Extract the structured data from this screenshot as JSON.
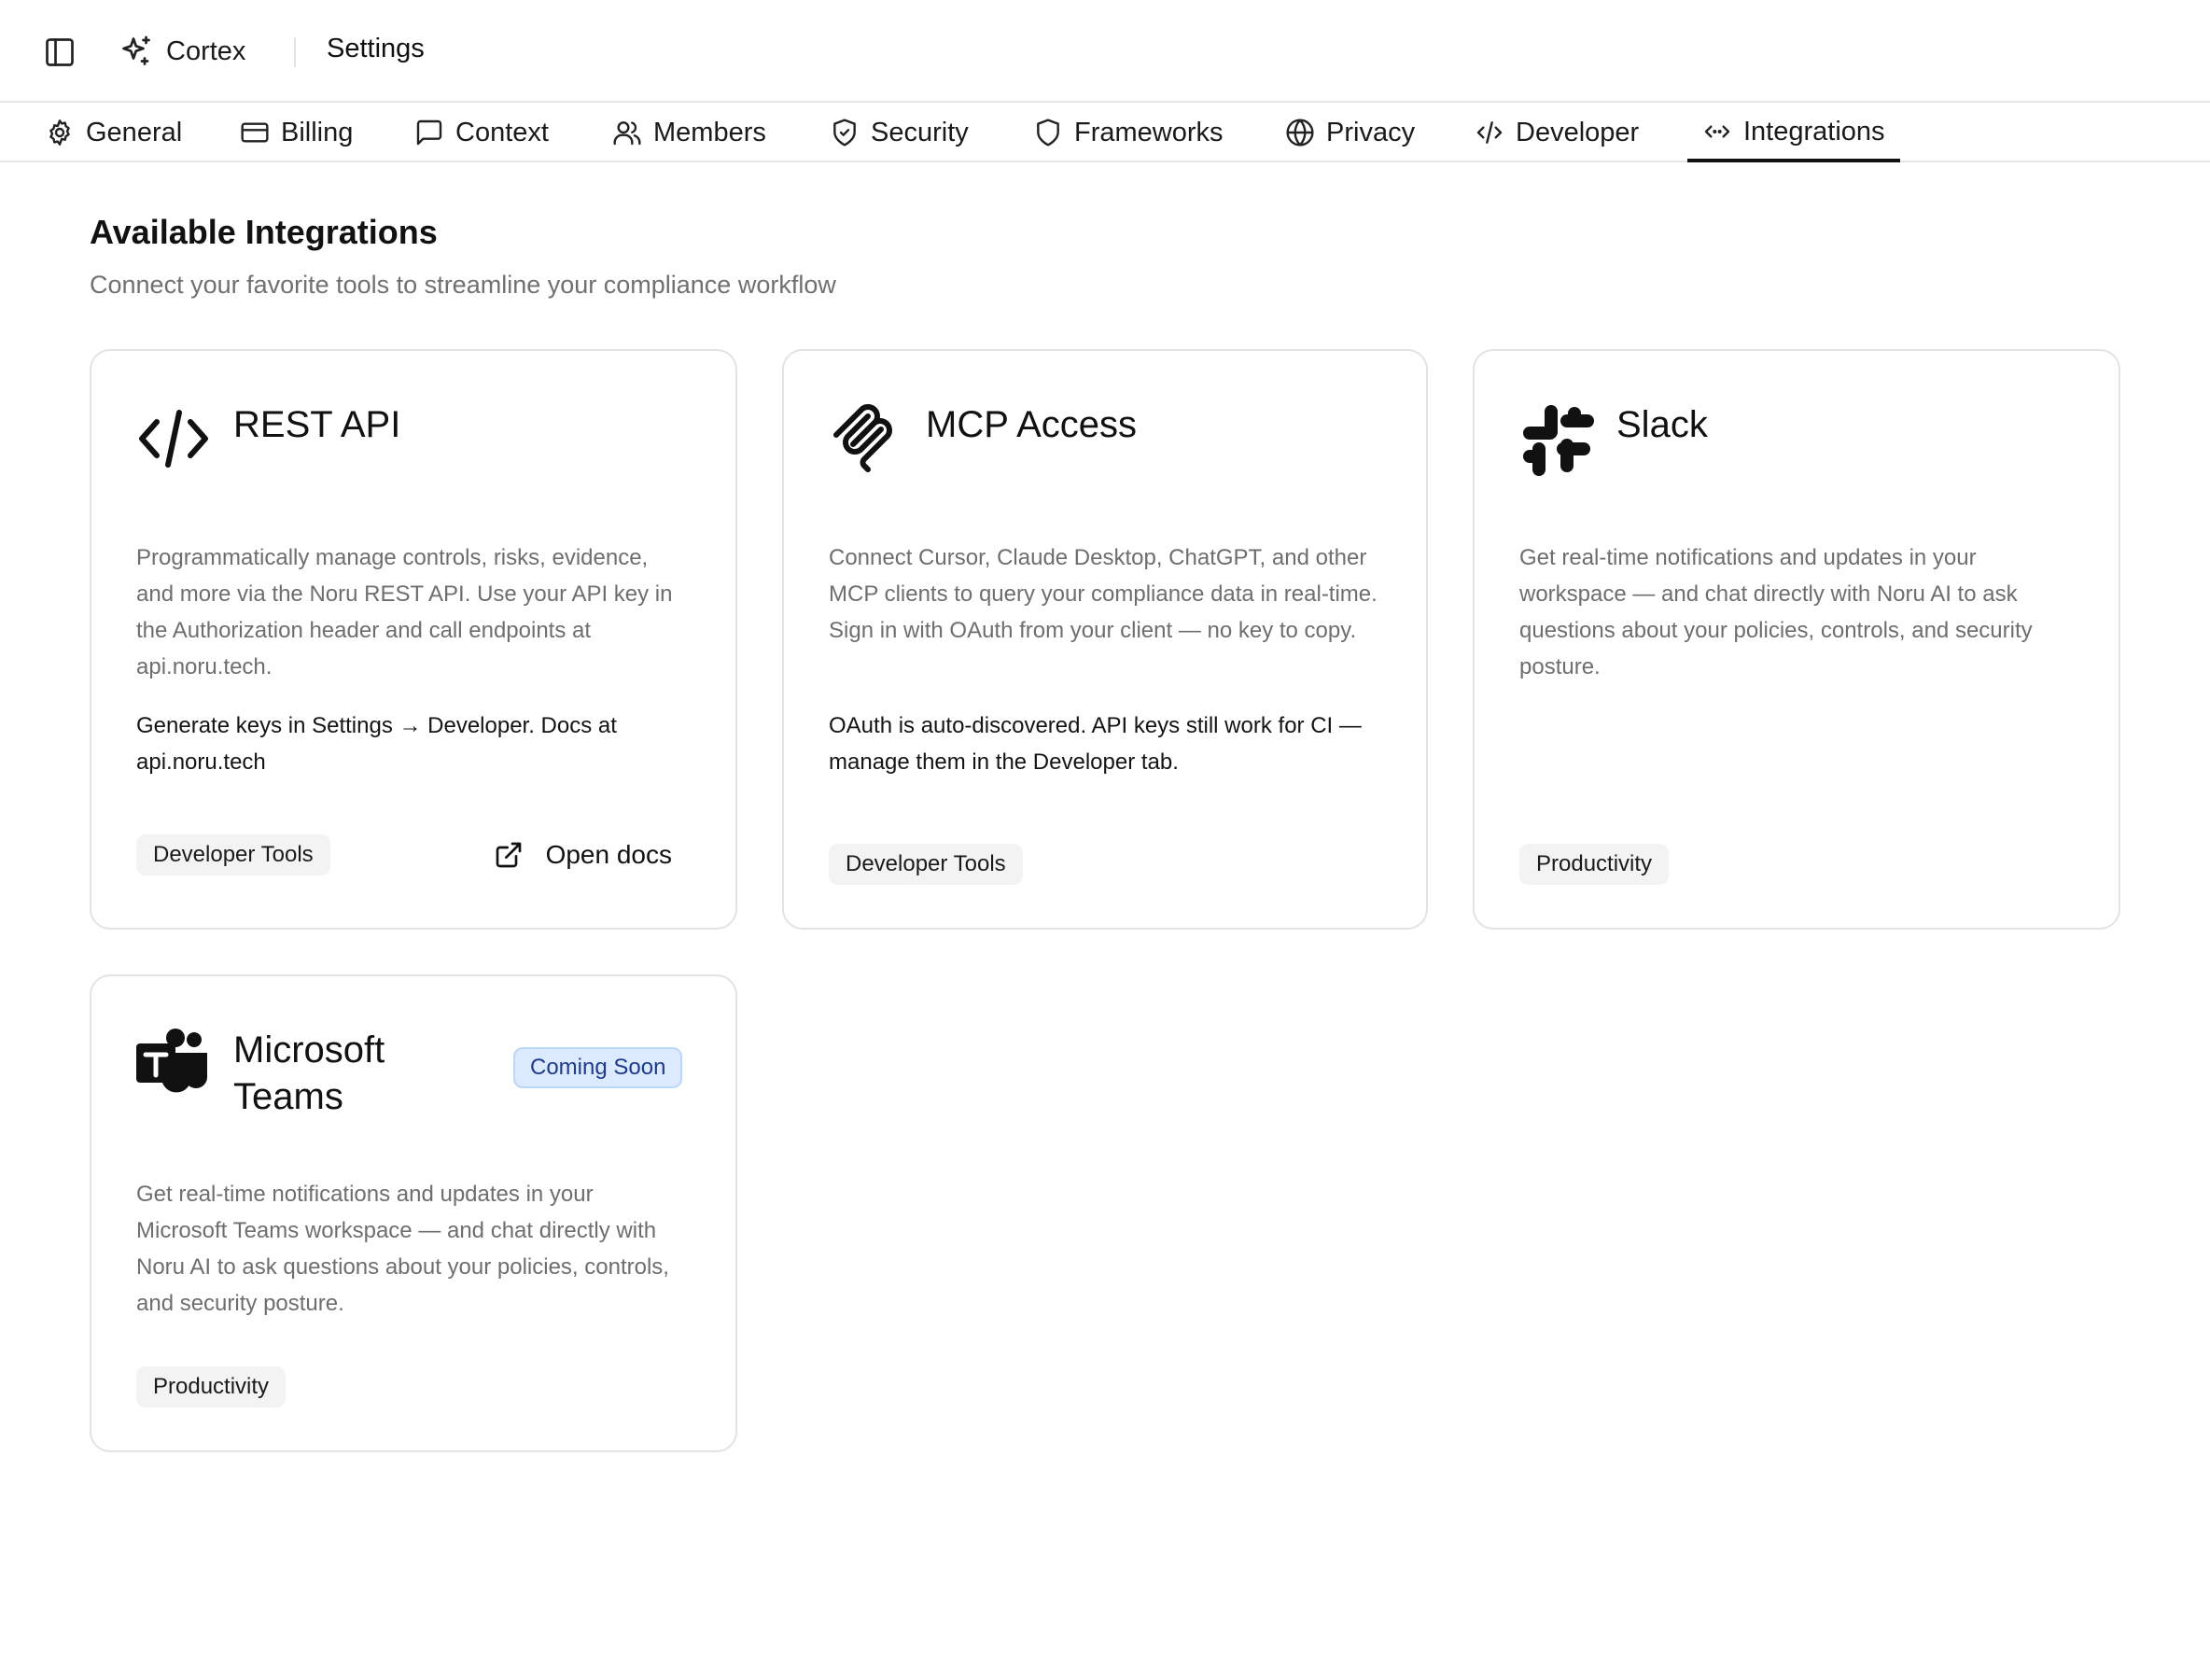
{
  "app": {
    "name": "Cortex",
    "breadcrumb": "Settings"
  },
  "tabs": [
    {
      "label": "General",
      "icon": "gear-icon"
    },
    {
      "label": "Billing",
      "icon": "credit-card-icon"
    },
    {
      "label": "Context",
      "icon": "message-square-icon"
    },
    {
      "label": "Members",
      "icon": "users-icon"
    },
    {
      "label": "Security",
      "icon": "shield-check-icon"
    },
    {
      "label": "Frameworks",
      "icon": "shield-icon"
    },
    {
      "label": "Privacy",
      "icon": "globe-lock-icon"
    },
    {
      "label": "Developer",
      "icon": "code-icon"
    },
    {
      "label": "Integrations",
      "icon": "code-xml-icon",
      "active": true
    }
  ],
  "page": {
    "title": "Available Integrations",
    "subtitle": "Connect your favorite tools to streamline your compliance workflow"
  },
  "integrations": [
    {
      "name": "REST API",
      "icon": "code-icon",
      "description": "Programmatically manage controls, risks, evidence, and more via the Noru REST API. Use your API key in the Authorization header and call endpoints at api.noru.tech.",
      "note": "Generate keys in Settings → Developer. Docs at api.noru.tech",
      "category": "Developer Tools",
      "action_label": "Open docs"
    },
    {
      "name": "MCP Access",
      "icon": "mcp-icon",
      "description": "Connect Cursor, Claude Desktop, ChatGPT, and other MCP clients to query your compliance data in real-time. Sign in with OAuth from your client — no key to copy.",
      "note": "OAuth is auto-discovered. API keys still work for CI — manage them in the Developer tab.",
      "category": "Developer Tools"
    },
    {
      "name": "Slack",
      "icon": "slack-icon",
      "description": "Get real-time notifications and updates in your workspace — and chat directly with Noru AI to ask questions about your policies, controls, and security posture.",
      "category": "Productivity"
    },
    {
      "name": "Microsoft Teams",
      "icon": "microsoft-teams-icon",
      "status": "Coming Soon",
      "description": "Get real-time notifications and updates in your Microsoft Teams workspace — and chat directly with Noru AI to ask questions about your policies, controls, and security posture.",
      "category": "Productivity"
    }
  ],
  "colors": {
    "active_tab": "#111111",
    "badge_bg": "#dbeafe",
    "badge_text": "#1e3a8a",
    "muted_text": "#6e6e6e"
  }
}
